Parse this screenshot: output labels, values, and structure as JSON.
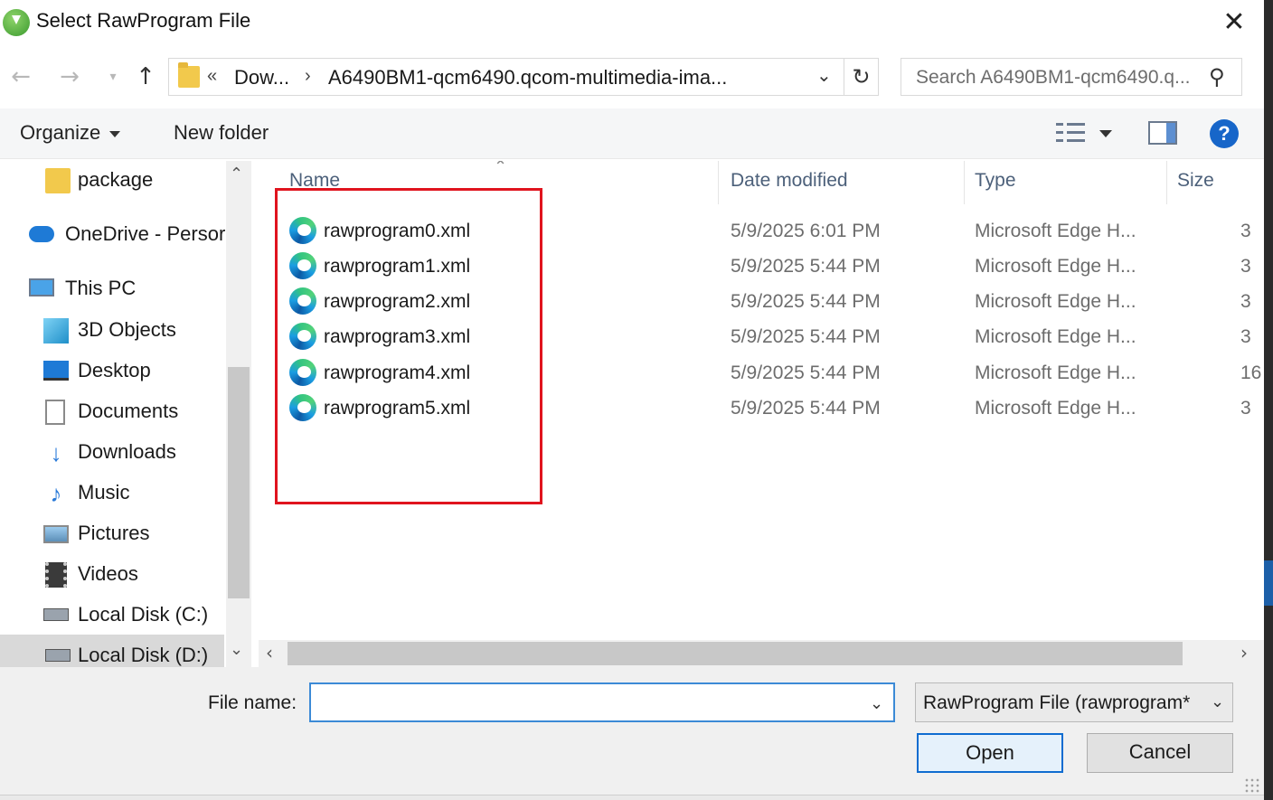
{
  "window": {
    "title": "Select RawProgram File"
  },
  "nav": {
    "back_icon": "arrow-left-icon",
    "forward_icon": "arrow-right-icon",
    "recent_icon": "chevron-down-icon",
    "up_icon": "arrow-up-icon",
    "address": {
      "overflow": "«",
      "crumbs": [
        "Dow...",
        "A6490BM1-qcm6490.qcom-multimedia-ima..."
      ],
      "separator": "›"
    },
    "search_placeholder": "Search A6490BM1-qcm6490.q..."
  },
  "toolbar": {
    "organize_label": "Organize",
    "new_folder_label": "New folder",
    "help_label": "?"
  },
  "sidebar": {
    "items": [
      {
        "label": "package",
        "icon": "folder-icon"
      },
      {
        "label": "OneDrive - Persor",
        "icon": "onedrive-icon"
      },
      {
        "label": "This PC",
        "icon": "computer-icon"
      },
      {
        "label": "3D Objects",
        "icon": "3d-objects-icon"
      },
      {
        "label": "Desktop",
        "icon": "desktop-icon"
      },
      {
        "label": "Documents",
        "icon": "documents-icon"
      },
      {
        "label": "Downloads",
        "icon": "downloads-icon"
      },
      {
        "label": "Music",
        "icon": "music-icon"
      },
      {
        "label": "Pictures",
        "icon": "pictures-icon"
      },
      {
        "label": "Videos",
        "icon": "videos-icon"
      },
      {
        "label": "Local Disk (C:)",
        "icon": "drive-icon"
      },
      {
        "label": "Local Disk (D:)",
        "icon": "drive-icon",
        "selected": true
      }
    ]
  },
  "filelist": {
    "columns": [
      "Name",
      "Date modified",
      "Type",
      "Size"
    ],
    "rows": [
      {
        "name": "rawprogram0.xml",
        "date": "5/9/2025 6:01 PM",
        "type": "Microsoft Edge H...",
        "size": "3"
      },
      {
        "name": "rawprogram1.xml",
        "date": "5/9/2025 5:44 PM",
        "type": "Microsoft Edge H...",
        "size": "3"
      },
      {
        "name": "rawprogram2.xml",
        "date": "5/9/2025 5:44 PM",
        "type": "Microsoft Edge H...",
        "size": "3"
      },
      {
        "name": "rawprogram3.xml",
        "date": "5/9/2025 5:44 PM",
        "type": "Microsoft Edge H...",
        "size": "3"
      },
      {
        "name": "rawprogram4.xml",
        "date": "5/9/2025 5:44 PM",
        "type": "Microsoft Edge H...",
        "size": "16"
      },
      {
        "name": "rawprogram5.xml",
        "date": "5/9/2025 5:44 PM",
        "type": "Microsoft Edge H...",
        "size": "3"
      }
    ],
    "highlight_color": "#e0141e"
  },
  "footer": {
    "file_name_label": "File name:",
    "file_name_value": "",
    "file_type_filter": "RawProgram File (rawprogram*",
    "open_label": "Open",
    "cancel_label": "Cancel"
  },
  "colors": {
    "accent": "#0f6cd0",
    "header_text": "#4c607a"
  }
}
